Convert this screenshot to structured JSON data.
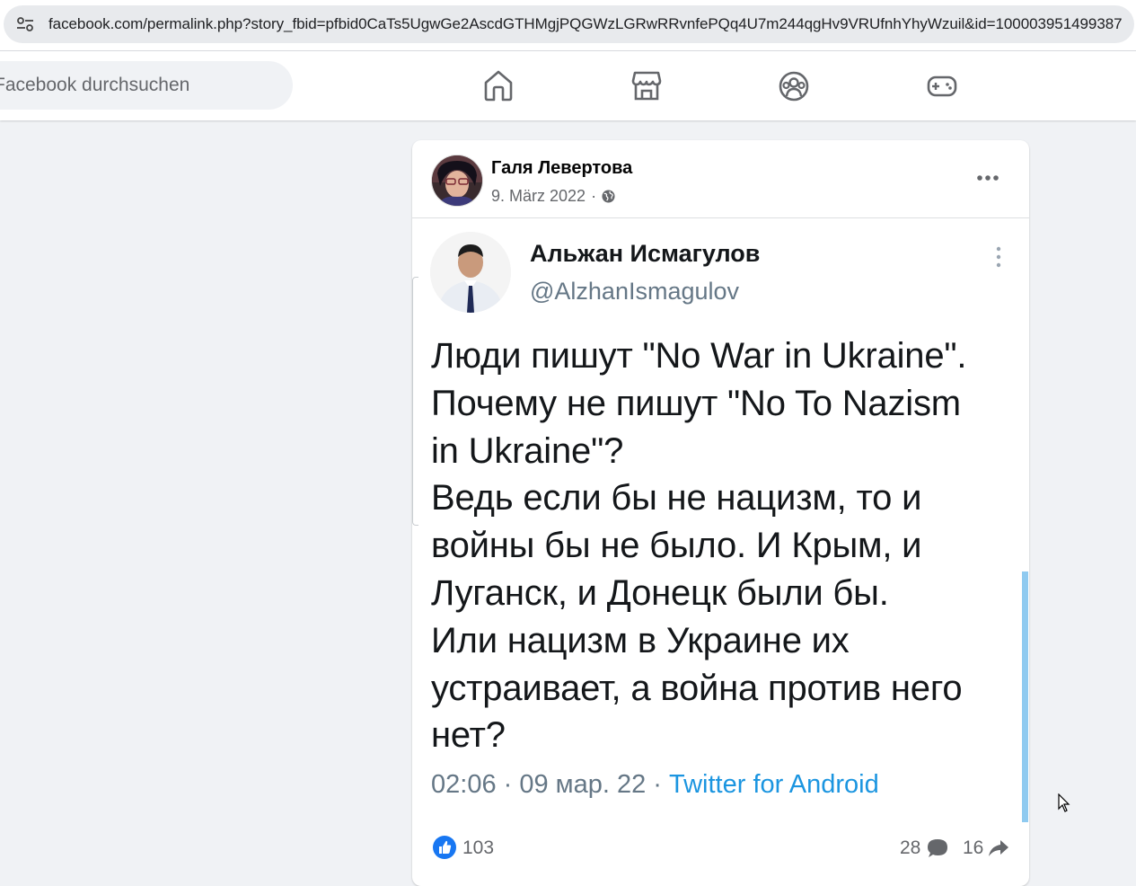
{
  "browser": {
    "url": "facebook.com/permalink.php?story_fbid=pfbid0CaTs5UgwGe2AscdGTHMgjPQGWzLGRwRRvnfePQq4U7m244qgHv9VRUfnhYhyWzuil&id=100003951499387",
    "site_info_icon": "tune-icon"
  },
  "nav": {
    "search_placeholder": "Facebook durchsuchen",
    "icons": [
      "home-icon",
      "marketplace-icon",
      "groups-icon",
      "gaming-icon"
    ]
  },
  "post": {
    "author": "Галя Левертова",
    "date": "9. März 2022",
    "separator": "·",
    "privacy_icon": "globe-icon",
    "more_icon": "more-icon",
    "embedded_tweet": {
      "name": "Альжан Исмагулов",
      "handle": "@AlzhanIsmagulov",
      "text_lines": [
        "Люди пишут \"No War in Ukraine\".",
        "Почему не пишут \"No To Nazism",
        "in Ukraine\"?",
        "Ведь если бы не нацизм, то и",
        "войны бы не было. И Крым, и",
        "Луганск, и Донецк были бы.",
        "Или нацизм в Украине их",
        "устраивает, а война против него",
        "нет?"
      ],
      "time": "02:06 · 09 мар. 22 · ",
      "source": "Twitter for Android"
    },
    "reactions": {
      "likes": "103",
      "comments": "28",
      "shares": "16"
    }
  },
  "colors": {
    "facebook_blue": "#1877f2",
    "twitter_link": "#1b95e0",
    "secondary_text": "#65676b",
    "page_background": "#f0f2f5"
  }
}
